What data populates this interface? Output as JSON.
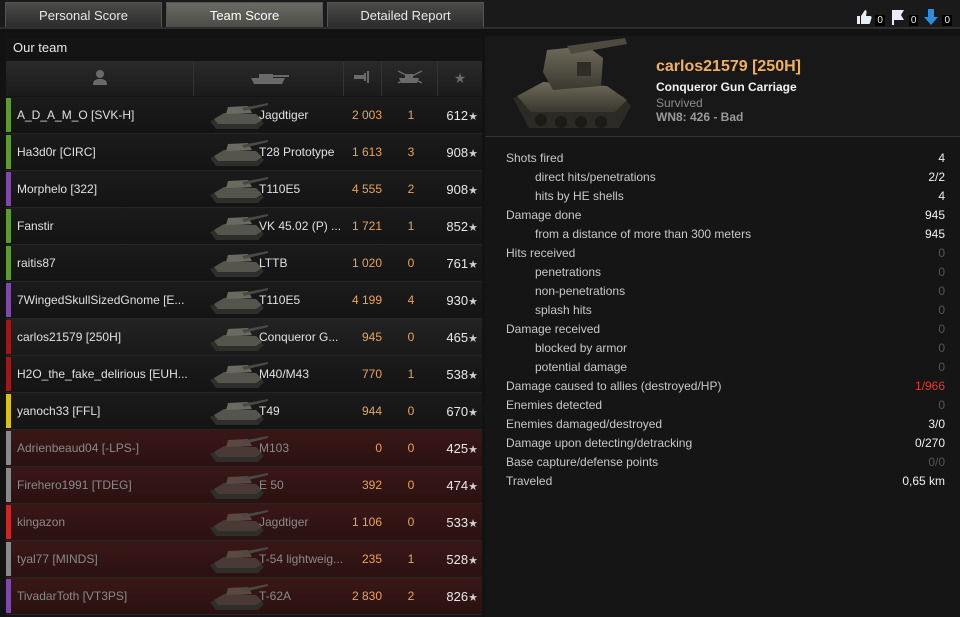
{
  "tabs": [
    {
      "label": "Personal Score",
      "active": false
    },
    {
      "label": "Team Score",
      "active": true
    },
    {
      "label": "Detailed Report",
      "active": false
    }
  ],
  "ratings": {
    "like": "0",
    "flag": "0",
    "dislike": "0"
  },
  "team": {
    "title": "Our team",
    "columns": [
      "player-icon",
      "tank-icon",
      "damage-icon",
      "frags-icon",
      "xp-star-icon"
    ],
    "players": [
      {
        "name": "A_D_A_M_O [SVK-H]",
        "tank": "Jagdtiger",
        "damage": "2 003",
        "kills": "1",
        "xp": "612",
        "bar": "#5f9a31",
        "status": "alive"
      },
      {
        "name": "Ha3d0r [CIRC]",
        "tank": "T28 Prototype",
        "damage": "1 613",
        "kills": "3",
        "xp": "908",
        "bar": "#5f9a31",
        "status": "alive"
      },
      {
        "name": "Morphelo [322]",
        "tank": "T110E5",
        "damage": "4 555",
        "kills": "2",
        "xp": "908",
        "bar": "#7d4aa8",
        "status": "alive"
      },
      {
        "name": "Fanstir",
        "tank": "VK 45.02 (P) ...",
        "damage": "1 721",
        "kills": "1",
        "xp": "852",
        "bar": "#5f9a31",
        "status": "alive"
      },
      {
        "name": "raitis87",
        "tank": "LTTB",
        "damage": "1 020",
        "kills": "0",
        "xp": "761",
        "bar": "#5f9a31",
        "status": "alive"
      },
      {
        "name": "7WingedSkullSizedGnome [E...",
        "tank": "T110E5",
        "damage": "4 199",
        "kills": "4",
        "xp": "930",
        "bar": "#7d4aa8",
        "status": "alive"
      },
      {
        "name": "carlos21579 [250H]",
        "tank": "Conqueror G...",
        "damage": "945",
        "kills": "0",
        "xp": "465",
        "bar": "#9a1a1a",
        "status": "self"
      },
      {
        "name": "H2O_the_fake_delirious [EUH...",
        "tank": "M40/M43",
        "damage": "770",
        "kills": "1",
        "xp": "538",
        "bar": "#9a1a1a",
        "status": "alive"
      },
      {
        "name": "yanoch33 [FFL]",
        "tank": "T49",
        "damage": "944",
        "kills": "0",
        "xp": "670",
        "bar": "#d8c21a",
        "status": "alive"
      },
      {
        "name": "Adrienbeaud04 [-LPS-]",
        "tank": "M103",
        "damage": "0",
        "kills": "0",
        "xp": "425",
        "bar": "#8a8a8a",
        "status": "dead"
      },
      {
        "name": "Firehero1991 [TDEG]",
        "tank": "E 50",
        "damage": "392",
        "kills": "0",
        "xp": "474",
        "bar": "#8a8a8a",
        "status": "dead"
      },
      {
        "name": "kingazon",
        "tank": "Jagdtiger",
        "damage": "1 106",
        "kills": "0",
        "xp": "533",
        "bar": "#c82828",
        "status": "dead"
      },
      {
        "name": "tyal77 [MINDS]",
        "tank": "T-54 lightweig...",
        "damage": "235",
        "kills": "1",
        "xp": "528",
        "bar": "#8a8a8a",
        "status": "dead"
      },
      {
        "name": "TivadarToth [VT3PS]",
        "tank": "T-62A",
        "damage": "2 830",
        "kills": "2",
        "xp": "826",
        "bar": "#7d4aa8",
        "status": "dead"
      }
    ]
  },
  "player": {
    "name": "carlos21579 [250H]",
    "tank": "Conqueror Gun Carriage",
    "status": "Survived",
    "wn8": "WN8: 426 - Bad"
  },
  "stats": [
    {
      "label": "Shots fired",
      "indent": false,
      "value": "4",
      "dim": false
    },
    {
      "label": "direct hits/penetrations",
      "indent": true,
      "value": "2/2",
      "dim": false
    },
    {
      "label": "hits by HE shells",
      "indent": true,
      "value": "4",
      "dim": false
    },
    {
      "label": "Damage done",
      "indent": false,
      "value": "945",
      "dim": false
    },
    {
      "label": "from a distance of more than 300 meters",
      "indent": true,
      "value": "945",
      "dim": false
    },
    {
      "label": "Hits received",
      "indent": false,
      "value": "0",
      "dim": true
    },
    {
      "label": "penetrations",
      "indent": true,
      "value": "0",
      "dim": true
    },
    {
      "label": "non-penetrations",
      "indent": true,
      "value": "0",
      "dim": true
    },
    {
      "label": "splash hits",
      "indent": true,
      "value": "0",
      "dim": true
    },
    {
      "label": "Damage received",
      "indent": false,
      "value": "0",
      "dim": true
    },
    {
      "label": "blocked by armor",
      "indent": true,
      "value": "0",
      "dim": true
    },
    {
      "label": "potential damage",
      "indent": true,
      "value": "0",
      "dim": true
    },
    {
      "label": "Damage caused to allies (destroyed/HP)",
      "indent": false,
      "value": "1/966",
      "dim": false,
      "red": true
    },
    {
      "label": "Enemies detected",
      "indent": false,
      "value": "0",
      "dim": true
    },
    {
      "label": "Enemies damaged/destroyed",
      "indent": false,
      "value": "3/0",
      "dim": false
    },
    {
      "label": "Damage upon detecting/detracking",
      "indent": false,
      "value": "0/270",
      "dim": false
    },
    {
      "label": "Base capture/defense points",
      "indent": false,
      "value": "0/0",
      "dim": true
    },
    {
      "label": "Traveled",
      "indent": false,
      "value": "0,65 km",
      "dim": false
    }
  ]
}
